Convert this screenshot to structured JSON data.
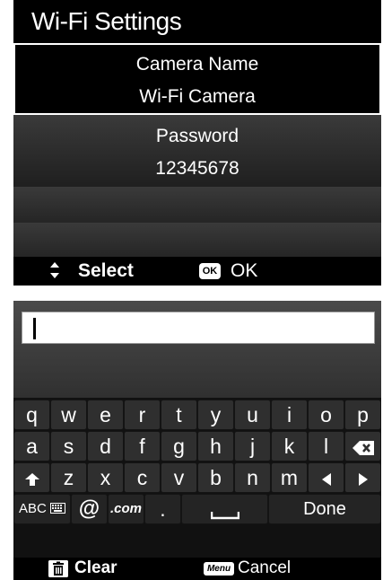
{
  "wifi_settings": {
    "title": "Wi-Fi Settings",
    "camera_name_label": "Camera Name",
    "camera_name_value": "Wi-Fi Camera",
    "password_label": "Password",
    "password_value": "12345678",
    "footer": {
      "select_icon": "up-down-arrows-icon",
      "select_label": "Select",
      "ok_badge": "OK",
      "ok_label": "OK"
    }
  },
  "keyboard_screen": {
    "input_value": "",
    "keys": {
      "row1": [
        "q",
        "w",
        "e",
        "r",
        "t",
        "y",
        "u",
        "i",
        "o",
        "p"
      ],
      "row2": [
        "a",
        "s",
        "d",
        "f",
        "g",
        "h",
        "j",
        "k",
        "l"
      ],
      "row2_backspace_icon": "backspace-icon",
      "row3": [
        "z",
        "x",
        "c",
        "v",
        "b",
        "n",
        "m"
      ],
      "row3_shift_icon": "shift-icon",
      "row3_left_icon": "cursor-left-icon",
      "row3_right_icon": "cursor-right-icon",
      "mode_key": "ABC",
      "at_key": "@",
      "com_key": ".com",
      "dot_key": ".",
      "space_icon": "space-icon",
      "done_key": "Done"
    },
    "footer": {
      "clear_icon": "trash-icon",
      "clear_label": "Clear",
      "menu_badge": "Menu",
      "cancel_label": "Cancel"
    }
  }
}
